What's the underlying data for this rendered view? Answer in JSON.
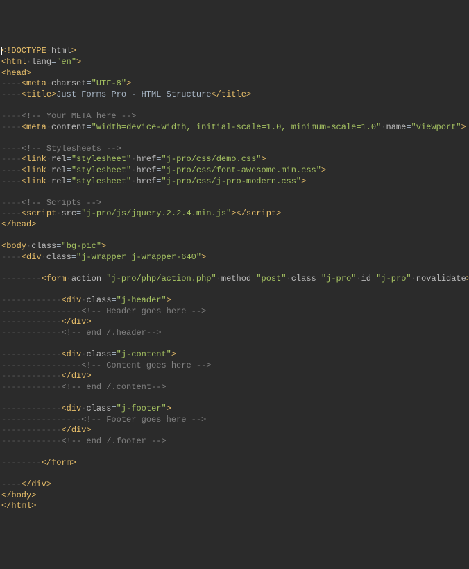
{
  "lines": [
    {
      "indent": 0,
      "type": "doctype",
      "text": "!DOCTYPE",
      "after": "html",
      "cursor": true
    },
    {
      "indent": 0,
      "type": "open",
      "tag": "html",
      "attrs": [
        [
          "lang",
          "en"
        ]
      ]
    },
    {
      "indent": 0,
      "type": "open",
      "tag": "head"
    },
    {
      "indent": 1,
      "type": "selfclosed",
      "tag": "meta",
      "attrs": [
        [
          "charset",
          "UTF-8"
        ]
      ]
    },
    {
      "indent": 1,
      "type": "paired",
      "tag": "title",
      "text": "Just Forms Pro - HTML Structure"
    },
    {
      "indent": 0,
      "type": "blank"
    },
    {
      "indent": 1,
      "type": "comment",
      "text": " Your META here "
    },
    {
      "indent": 1,
      "type": "selfclosed",
      "tag": "meta",
      "attrs": [
        [
          "content",
          "width=device-width, initial-scale=1.0, minimum-scale=1.0"
        ],
        [
          "name",
          "viewport"
        ]
      ]
    },
    {
      "indent": 0,
      "type": "blank"
    },
    {
      "indent": 1,
      "type": "comment",
      "text": " Stylesheets "
    },
    {
      "indent": 1,
      "type": "selfclosed",
      "tag": "link",
      "attrs": [
        [
          "rel",
          "stylesheet"
        ],
        [
          "href",
          "j-pro/css/demo.css"
        ]
      ]
    },
    {
      "indent": 1,
      "type": "selfclosed",
      "tag": "link",
      "attrs": [
        [
          "rel",
          "stylesheet"
        ],
        [
          "href",
          "j-pro/css/font-awesome.min.css"
        ]
      ]
    },
    {
      "indent": 1,
      "type": "selfclosed",
      "tag": "link",
      "attrs": [
        [
          "rel",
          "stylesheet"
        ],
        [
          "href",
          "j-pro/css/j-pro-modern.css"
        ]
      ]
    },
    {
      "indent": 0,
      "type": "blank"
    },
    {
      "indent": 1,
      "type": "comment",
      "text": " Scripts "
    },
    {
      "indent": 1,
      "type": "paired",
      "tag": "script",
      "attrs": [
        [
          "src",
          "j-pro/js/jquery.2.2.4.min.js"
        ]
      ],
      "text": ""
    },
    {
      "indent": 0,
      "type": "close",
      "tag": "head"
    },
    {
      "indent": 0,
      "type": "blank"
    },
    {
      "indent": 0,
      "type": "open",
      "tag": "body",
      "attrs": [
        [
          "class",
          "bg-pic"
        ]
      ]
    },
    {
      "indent": 1,
      "type": "open",
      "tag": "div",
      "attrs": [
        [
          "class",
          "j-wrapper j-wrapper-640"
        ]
      ]
    },
    {
      "indent": 0,
      "type": "blank"
    },
    {
      "indent": 2,
      "type": "open",
      "tag": "form",
      "attrs": [
        [
          "action",
          "j-pro/php/action.php"
        ],
        [
          "method",
          "post"
        ],
        [
          "class",
          "j-pro"
        ],
        [
          "id",
          "j-pro"
        ]
      ],
      "boolattrs": [
        "novalidate"
      ]
    },
    {
      "indent": 0,
      "type": "blank"
    },
    {
      "indent": 3,
      "type": "open",
      "tag": "div",
      "attrs": [
        [
          "class",
          "j-header"
        ]
      ]
    },
    {
      "indent": 4,
      "type": "comment",
      "text": " Header goes here "
    },
    {
      "indent": 3,
      "type": "close",
      "tag": "div"
    },
    {
      "indent": 3,
      "type": "comment",
      "text": " end /.header"
    },
    {
      "indent": 0,
      "type": "blank"
    },
    {
      "indent": 3,
      "type": "open",
      "tag": "div",
      "attrs": [
        [
          "class",
          "j-content"
        ]
      ]
    },
    {
      "indent": 4,
      "type": "comment",
      "text": " Content goes here "
    },
    {
      "indent": 3,
      "type": "close",
      "tag": "div"
    },
    {
      "indent": 3,
      "type": "comment",
      "text": " end /.content"
    },
    {
      "indent": 0,
      "type": "blank"
    },
    {
      "indent": 3,
      "type": "open",
      "tag": "div",
      "attrs": [
        [
          "class",
          "j-footer"
        ]
      ]
    },
    {
      "indent": 4,
      "type": "comment",
      "text": " Footer goes here "
    },
    {
      "indent": 3,
      "type": "close",
      "tag": "div"
    },
    {
      "indent": 3,
      "type": "comment",
      "text": " end /.footer "
    },
    {
      "indent": 0,
      "type": "blank"
    },
    {
      "indent": 2,
      "type": "close",
      "tag": "form"
    },
    {
      "indent": 0,
      "type": "blank"
    },
    {
      "indent": 1,
      "type": "close",
      "tag": "div"
    },
    {
      "indent": 0,
      "type": "close",
      "tag": "body"
    },
    {
      "indent": 0,
      "type": "close",
      "tag": "html"
    }
  ],
  "indent_unit": "----",
  "indent_sep": "·"
}
